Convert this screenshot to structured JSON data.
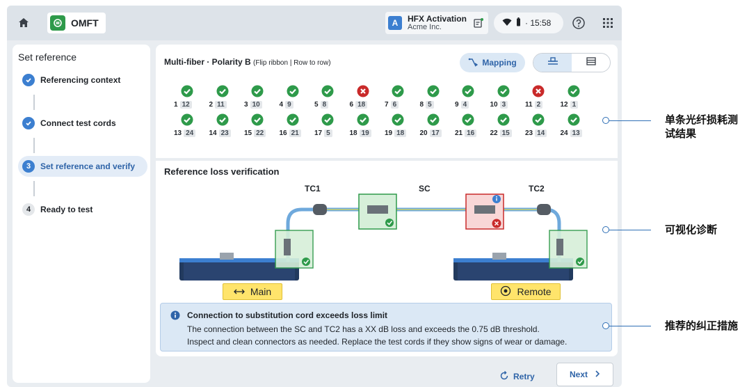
{
  "topbar": {
    "app_name": "OMFT",
    "license_badge": "A",
    "license_title": "HFX Activation",
    "license_org": "Acme Inc.",
    "time": "· 15:58",
    "icons": [
      "home-icon",
      "app-logo-icon",
      "edit-notification-icon",
      "wifi-icon",
      "battery-icon",
      "help-icon",
      "apps-grid-icon"
    ]
  },
  "sidebar": {
    "title": "Set reference",
    "steps": [
      {
        "label": "Referencing context",
        "state": "done",
        "num": ""
      },
      {
        "label": "Connect test cords",
        "state": "done",
        "num": ""
      },
      {
        "label": "Set reference and verify",
        "state": "current",
        "num": "3"
      },
      {
        "label": "Ready to test",
        "state": "todo",
        "num": "4"
      }
    ]
  },
  "fiber_panel": {
    "title": "Multi-fiber · Polarity B",
    "title_note": "(Flip ribbon | Row to row)",
    "mapping_label": "Mapping",
    "fibers": [
      {
        "n": "1",
        "m": "12",
        "ok": true
      },
      {
        "n": "2",
        "m": "11",
        "ok": true
      },
      {
        "n": "3",
        "m": "10",
        "ok": true
      },
      {
        "n": "4",
        "m": "9",
        "ok": true
      },
      {
        "n": "5",
        "m": "8",
        "ok": true
      },
      {
        "n": "6",
        "m": "18",
        "ok": false
      },
      {
        "n": "7",
        "m": "6",
        "ok": true
      },
      {
        "n": "8",
        "m": "5",
        "ok": true
      },
      {
        "n": "9",
        "m": "4",
        "ok": true
      },
      {
        "n": "10",
        "m": "3",
        "ok": true
      },
      {
        "n": "11",
        "m": "2",
        "ok": false
      },
      {
        "n": "12",
        "m": "1",
        "ok": true
      },
      {
        "n": "13",
        "m": "24",
        "ok": true
      },
      {
        "n": "14",
        "m": "23",
        "ok": true
      },
      {
        "n": "15",
        "m": "22",
        "ok": true
      },
      {
        "n": "16",
        "m": "21",
        "ok": true
      },
      {
        "n": "17",
        "m": "5",
        "ok": true
      },
      {
        "n": "18",
        "m": "19",
        "ok": true
      },
      {
        "n": "19",
        "m": "18",
        "ok": true
      },
      {
        "n": "20",
        "m": "17",
        "ok": true
      },
      {
        "n": "21",
        "m": "16",
        "ok": true
      },
      {
        "n": "22",
        "m": "15",
        "ok": true
      },
      {
        "n": "23",
        "m": "14",
        "ok": true
      },
      {
        "n": "24",
        "m": "13",
        "ok": true
      }
    ]
  },
  "verification": {
    "title": "Reference loss verification",
    "tc1": "TC1",
    "sc": "SC",
    "tc2": "TC2",
    "main_label": "Main",
    "remote_label": "Remote"
  },
  "alert": {
    "title": "Connection to substitution cord exceeds loss limit",
    "line1": "The connection between the SC and TC2 has a XX dB loss and exceeds the 0.75 dB threshold.",
    "line2": "Inspect and clean connectors as needed. Replace the test cords if they show signs of wear or damage."
  },
  "actions": {
    "retry": "Retry",
    "next": "Next"
  },
  "callouts": {
    "fiber_results_1": "单条光纤损耗测",
    "fiber_results_2": "试结果",
    "visual": "可视化诊断",
    "actions": "推荐的纠正措施"
  },
  "colors": {
    "ok": "#2e9a4a",
    "fail": "#c92a2a",
    "accent": "#3c7fd0",
    "highlight": "#ffe46b"
  }
}
